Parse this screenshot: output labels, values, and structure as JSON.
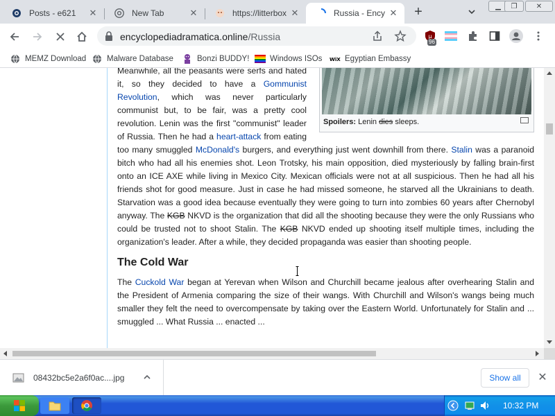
{
  "tabs": [
    {
      "title": "Posts - e621",
      "icon": "e621-icon"
    },
    {
      "title": "New Tab",
      "icon": "chrome-icon"
    },
    {
      "title": "https://litterbox",
      "icon": "litterbox-icon"
    },
    {
      "title": "Russia - Encyclo",
      "icon": "loading-icon",
      "active": true
    }
  ],
  "omnibox": {
    "domain": "encyclopediadramatica.online",
    "path": "/Russia"
  },
  "extensions": {
    "ublock_badge": "96"
  },
  "bookmarks": [
    {
      "label": "MEMZ Download",
      "icon": "globe-icon"
    },
    {
      "label": "Malware Database",
      "icon": "globe-icon"
    },
    {
      "label": "Bonzi BUDDY!",
      "icon": "bonzi-icon"
    },
    {
      "label": "Windows ISOs",
      "icon": "rainbow-flag-icon"
    },
    {
      "label": "Egyptian Embassy",
      "icon": "wix-icon"
    }
  ],
  "article": {
    "p1": {
      "t1": "Meanwhile, all the peasants were serfs and hated it, so they decided to have a ",
      "link1": "Gommunist Revolution",
      "t2": ", which was never particularly communist but, to be fair, was a pretty cool revolution. Lenin was the first \"communist\" leader of Russia. Then he had a ",
      "link2": "heart-attack",
      "t3": " from eating too many smuggled ",
      "link3": "McDonald's",
      "t4": " burgers, and everything just went downhill from there. ",
      "link4": "Stalin",
      "t5": " was a paranoid bitch who had all his enemies shot. Leon Trotsky, his main opposition, died mysteriously by falling brain-first onto an ICE AXE while living in Mexico City. Mexican officials were not at all suspicious. Then he had all his friends shot for good measure. Just in case he had missed someone, he starved all the Ukrainians to death. Starvation was a good idea because eventually they were going to turn into zombies 60 years after Chernobyl anyway. The ",
      "strike1": "KGB",
      "t6": " NKVD is the organization that did all the shooting because they were the only Russians who could be trusted not to shoot Stalin. The ",
      "strike2": "KGB",
      "t7": " NKVD ended up shooting itself multiple times, including the organization's leader. After a while, they decided propaganda was easier than shooting people."
    },
    "caption": {
      "bold": "Spoilers:",
      "t1": " Lenin ",
      "strike": "dies",
      "t2": " sleeps."
    },
    "heading": "The Cold War",
    "p2": {
      "t1": "The ",
      "link1": "Cuckold War",
      "t2": " began at Yerevan when Wilson and Churchill became jealous after overhearing Stalin and the President of Armenia comparing the size of their wangs. With Churchill and Wilson's wangs being much smaller they felt the need to overcompensate by taking over the Eastern World. Unfortunately for Stalin and ... smuggled ... What Russia ... enacted ..."
    }
  },
  "downloads": {
    "filename": "08432bc5e2a6f0ac....jpg",
    "show_all": "Show all"
  },
  "taskbar": {
    "clock": "10:32 PM"
  },
  "colors": {
    "link": "#0645ad",
    "tabstrip": "#dee1e6",
    "taskbar": "#2157d7",
    "start": "#3c9a3c"
  }
}
